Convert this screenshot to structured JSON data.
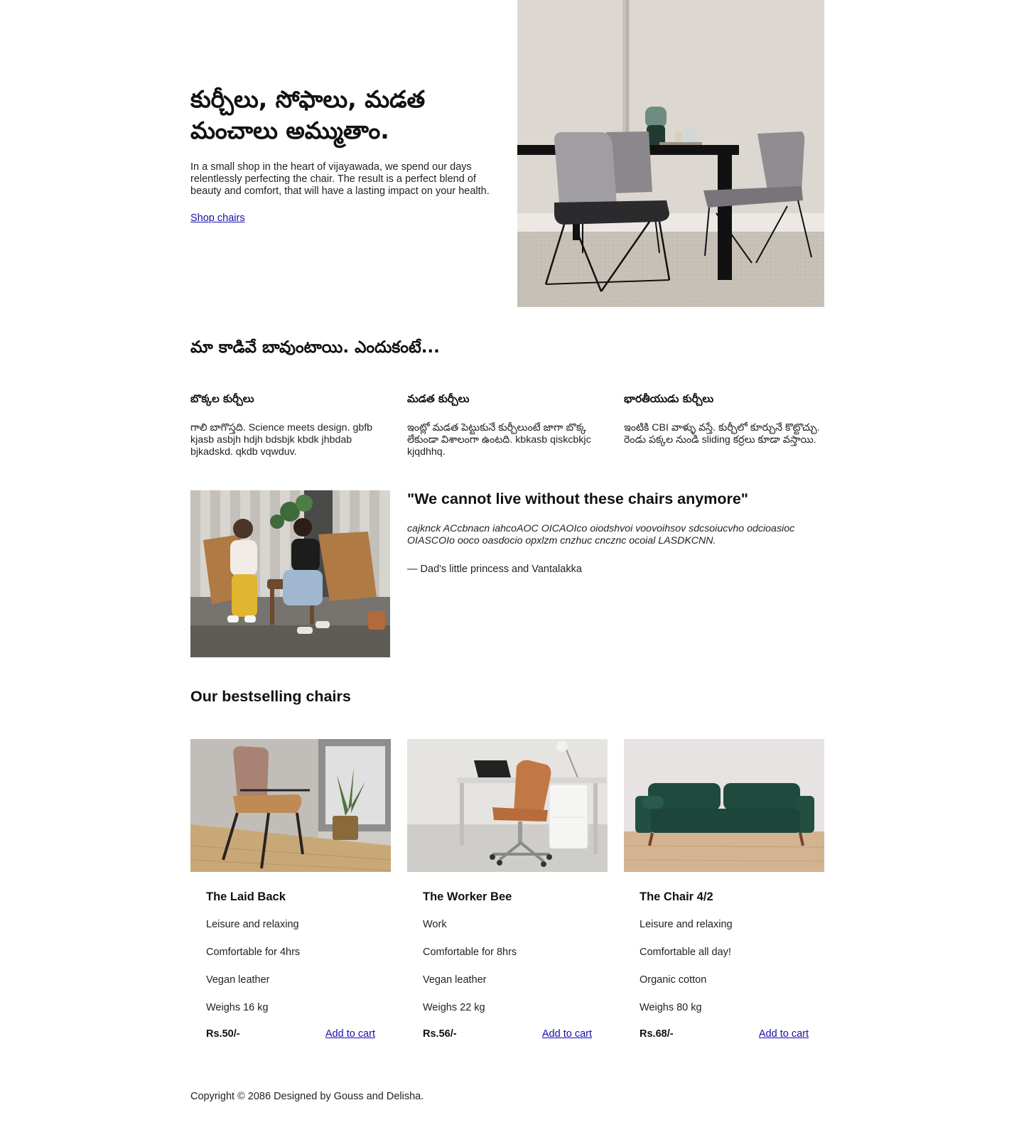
{
  "hero": {
    "title": "కుర్చీలు, సోఫాలు, మడత మంచాలు అమ్ముతాం.",
    "description": "In a small shop in the heart of vijayawada, we spend our days relentlessly perfecting the chair. The result is a perfect blend of beauty and comfort, that will have a lasting impact on your health.",
    "link_label": "Shop chairs"
  },
  "why": {
    "title": "మా కాడివే బావుంటాయి. ఎందుకంటే...",
    "features": [
      {
        "title": "బొక్కల కుర్చీలు",
        "text": "గాలి బాగొస్తది. Science meets design. gbfb kjasb asbjh hdjh bdsbjk kbdk jhbdab bjkadskd. qkdb vqwduv."
      },
      {
        "title": "మడత కుర్చీలు",
        "text": "ఇంట్లో మడత పెట్టుకునే కుర్చీలుంటే జాగా బొక్క లేకుండా విశాలంగా ఉంటది. kbkasb qiskcbkjc kjqdhhq."
      },
      {
        "title": "భారతీయుడు కుర్చీలు",
        "text": "ఇంటికి CBI వాళ్ళు వస్తే. కుర్చీలో కూర్చునే కొట్టొచ్చు. రెండు పక్కల నుండి sliding కర్రలు కూడా వస్తాయి."
      }
    ]
  },
  "testimonial": {
    "quote": "\"We cannot live without these chairs anymore\"",
    "body": "cajknck ACcbnacn iahcoAOC OICAOIco oiodshvoi voovoihsov sdcsoiucvho odcioasioc OIASCOIo oocо oasdocio opxlzm cnzhuc cncznc ocoial LASDKCNN.",
    "author": "— Dad's little princess and Vantalakka"
  },
  "bestsellers": {
    "title": "Our bestselling chairs",
    "products": [
      {
        "name": "The Laid Back",
        "attrs": [
          "Leisure and relaxing",
          "Comfortable for 4hrs",
          "Vegan leather",
          "Weighs 16 kg"
        ],
        "price": "Rs.50/-",
        "cart_label": "Add to cart"
      },
      {
        "name": "The Worker Bee",
        "attrs": [
          "Work",
          "Comfortable for 8hrs",
          "Vegan leather",
          "Weighs 22 kg"
        ],
        "price": "Rs.56/-",
        "cart_label": "Add to cart"
      },
      {
        "name": "The Chair 4/2",
        "attrs": [
          "Leisure and relaxing",
          "Comfortable all day!",
          "Organic cotton",
          "Weighs 80 kg"
        ],
        "price": "Rs.68/-",
        "cart_label": "Add to cart"
      }
    ]
  },
  "footer": {
    "copyright": "Copyright © 2086 Designed by Gouss and Delisha."
  },
  "colors": {
    "link": "#1a0dab",
    "text": "#111111",
    "sofa_green": "#1f4a3e",
    "leather_tan": "#b8794a"
  }
}
